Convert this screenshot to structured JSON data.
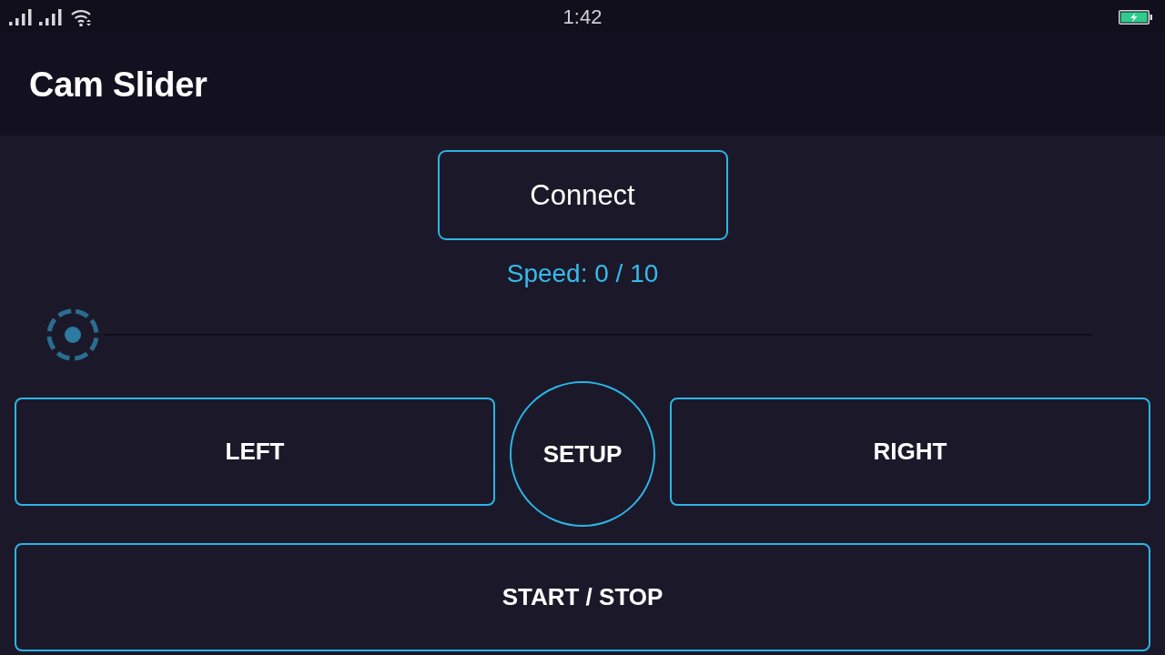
{
  "status_bar": {
    "time": "1:42"
  },
  "app_bar": {
    "title": "Cam Slider"
  },
  "connect_button": {
    "label": "Connect"
  },
  "speed_slider": {
    "reading": "Speed: 0 / 10",
    "level": 0
  },
  "controls": [
    {
      "label": "LEFT",
      "kind": "rect"
    },
    {
      "label": "SETUP",
      "kind": "round"
    },
    {
      "label": "RIGHT",
      "kind": "rect"
    }
  ],
  "start_stop_button": {
    "label": "START / STOP"
  }
}
